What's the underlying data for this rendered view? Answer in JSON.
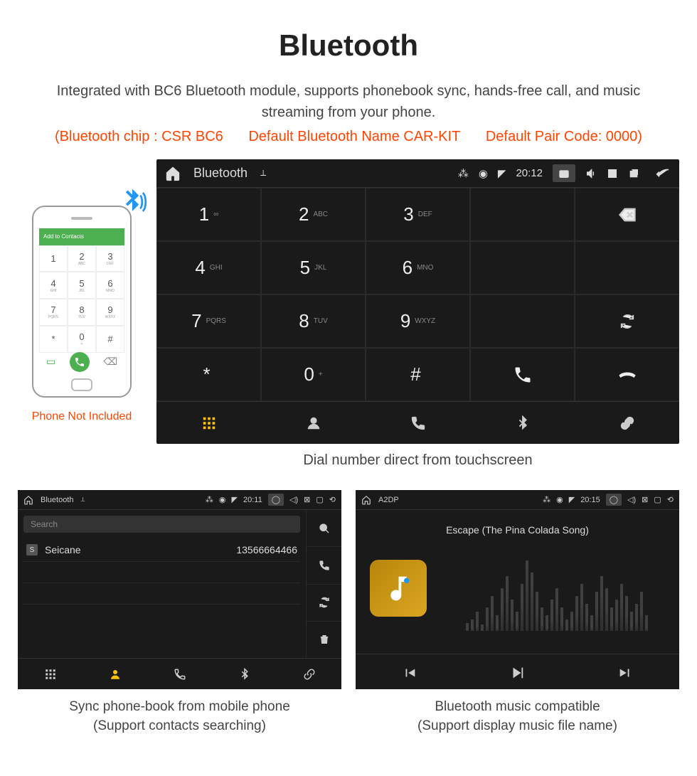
{
  "title": "Bluetooth",
  "subtitle": "Integrated with BC6 Bluetooth module, supports phonebook sync, hands-free call, and music streaming from your phone.",
  "specs": {
    "chip": "(Bluetooth chip : CSR BC6",
    "name": "Default Bluetooth Name CAR-KIT",
    "code": "Default Pair Code: 0000)"
  },
  "phone": {
    "header": "Add to Contacts",
    "note": "Phone Not Included",
    "keys": [
      {
        "n": "1",
        "l": ""
      },
      {
        "n": "2",
        "l": "ABC"
      },
      {
        "n": "3",
        "l": "DEF"
      },
      {
        "n": "4",
        "l": "GHI"
      },
      {
        "n": "5",
        "l": "JKL"
      },
      {
        "n": "6",
        "l": "MNO"
      },
      {
        "n": "7",
        "l": "PQRS"
      },
      {
        "n": "8",
        "l": "TUV"
      },
      {
        "n": "9",
        "l": "WXYZ"
      },
      {
        "n": "*",
        "l": ""
      },
      {
        "n": "0",
        "l": "+"
      },
      {
        "n": "#",
        "l": ""
      }
    ]
  },
  "main_unit": {
    "app_title": "Bluetooth",
    "time": "20:12",
    "keys": [
      {
        "n": "1",
        "l": "∞"
      },
      {
        "n": "2",
        "l": "ABC"
      },
      {
        "n": "3",
        "l": "DEF"
      },
      {
        "n": "4",
        "l": "GHI"
      },
      {
        "n": "5",
        "l": "JKL"
      },
      {
        "n": "6",
        "l": "MNO"
      },
      {
        "n": "7",
        "l": "PQRS"
      },
      {
        "n": "8",
        "l": "TUV"
      },
      {
        "n": "9",
        "l": "WXYZ"
      },
      {
        "n": "*",
        "l": ""
      },
      {
        "n": "0",
        "l": "+"
      },
      {
        "n": "#",
        "l": ""
      }
    ],
    "caption": "Dial number direct from touchscreen"
  },
  "contacts_unit": {
    "app_title": "Bluetooth",
    "time": "20:11",
    "search_placeholder": "Search",
    "contact": {
      "badge": "S",
      "name": "Seicane",
      "number": "13566664466"
    },
    "caption_line1": "Sync phone-book from mobile phone",
    "caption_line2": "(Support contacts searching)"
  },
  "music_unit": {
    "app_title": "A2DP",
    "time": "20:15",
    "song": "Escape (The Pina Colada Song)",
    "caption_line1": "Bluetooth music compatible",
    "caption_line2": "(Support display music file name)"
  }
}
